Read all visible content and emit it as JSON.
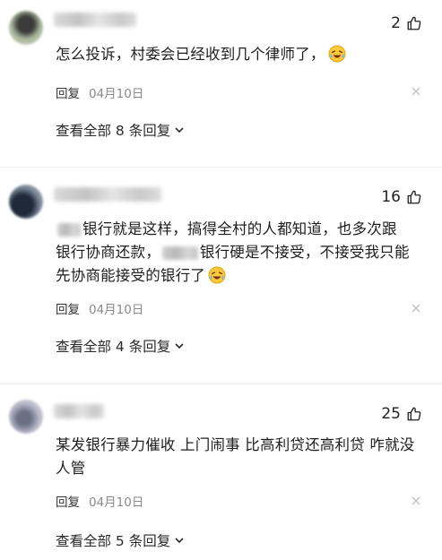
{
  "comments": [
    {
      "likes": "2",
      "text_a": "怎么投诉，村委会已经收到几个律师了，",
      "reply_label": "回复",
      "date": "04月10日",
      "expand_label": "查看全部 8 条回复"
    },
    {
      "likes": "16",
      "text_l1": "银行就是这样，搞得全村的人都知道，也多次跟",
      "text_l2a": "银行协商还款，",
      "text_l2b": "银行硬是不接受，不接受我只能",
      "text_l3": "先协商能接受的银行了",
      "reply_label": "回复",
      "date": "04月10日",
      "expand_label": "查看全部 4 条回复"
    },
    {
      "likes": "25",
      "text_l1": "某发银行暴力催收 上门闹事 比高利贷还高利贷 咋就没",
      "text_l2": "人管",
      "reply_label": "回复",
      "date": "04月10日",
      "expand_label": "查看全部 5 条回复"
    }
  ],
  "icons": {
    "like": "thumbs-up-icon",
    "emoji": "laughing-crying-emoji-icon",
    "dismiss": "close-icon",
    "expand": "chevron-down-icon"
  },
  "colors": {
    "text": "#1e1e1e",
    "meta": "#8a8a8a",
    "divider": "#ececec"
  }
}
